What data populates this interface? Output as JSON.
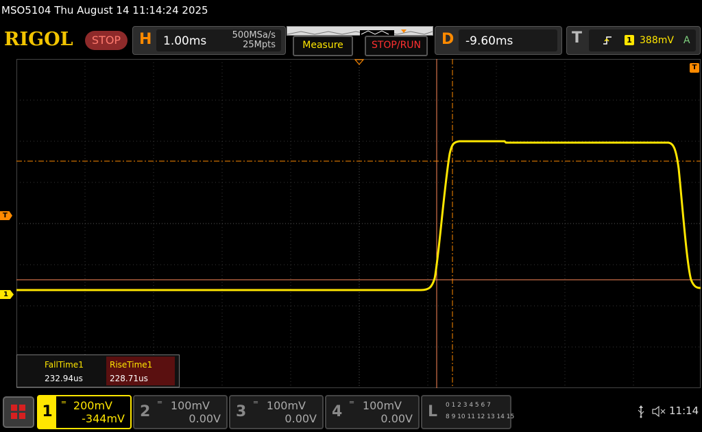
{
  "title": "MSO5104  Thu August 14 11:14:24 2025",
  "brand": "RIGOL",
  "run_state": "STOP",
  "horizontal": {
    "letter": "H",
    "timebase": "1.00ms",
    "sample_rate": "500MSa/s",
    "memory_depth": "25Mpts"
  },
  "buttons": {
    "measure": "Measure",
    "stop_run": "STOP/RUN"
  },
  "delay": {
    "letter": "D",
    "value": "-9.60ms"
  },
  "trigger": {
    "letter": "T",
    "source": "1",
    "level": "388mV",
    "mode": "A"
  },
  "markers": {
    "trigger_tag": "T",
    "ch1_tag": "1",
    "pos_tag": "T"
  },
  "measurements": {
    "fall_label": "FallTime1",
    "fall_value": "232.94us",
    "rise_label": "RiseTime1",
    "rise_value": "228.71us"
  },
  "channels": [
    {
      "num": "1",
      "scale": "200mV",
      "offset": "-344mV",
      "color": "#ffe600",
      "active": true
    },
    {
      "num": "2",
      "scale": "100mV",
      "offset": "0.00V",
      "color": "#888888",
      "active": false
    },
    {
      "num": "3",
      "scale": "100mV",
      "offset": "0.00V",
      "color": "#888888",
      "active": false
    },
    {
      "num": "4",
      "scale": "100mV",
      "offset": "0.00V",
      "color": "#888888",
      "active": false
    }
  ],
  "logic": {
    "letter": "L",
    "row1": "0 1 2 3  4 5 6 7",
    "row2": "8 9 10 11 12 13 14 15"
  },
  "status": {
    "time": "11:14"
  },
  "icons": {
    "menu": "menu-grid-icon",
    "usb": "usb-icon",
    "mute": "speaker-muted-icon",
    "ground": "ground-icon",
    "trig_edge": "rising-edge-icon"
  },
  "colors": {
    "ch1": "#ffe600",
    "accent": "#ff8a00",
    "grid": "#3a3a3a"
  }
}
